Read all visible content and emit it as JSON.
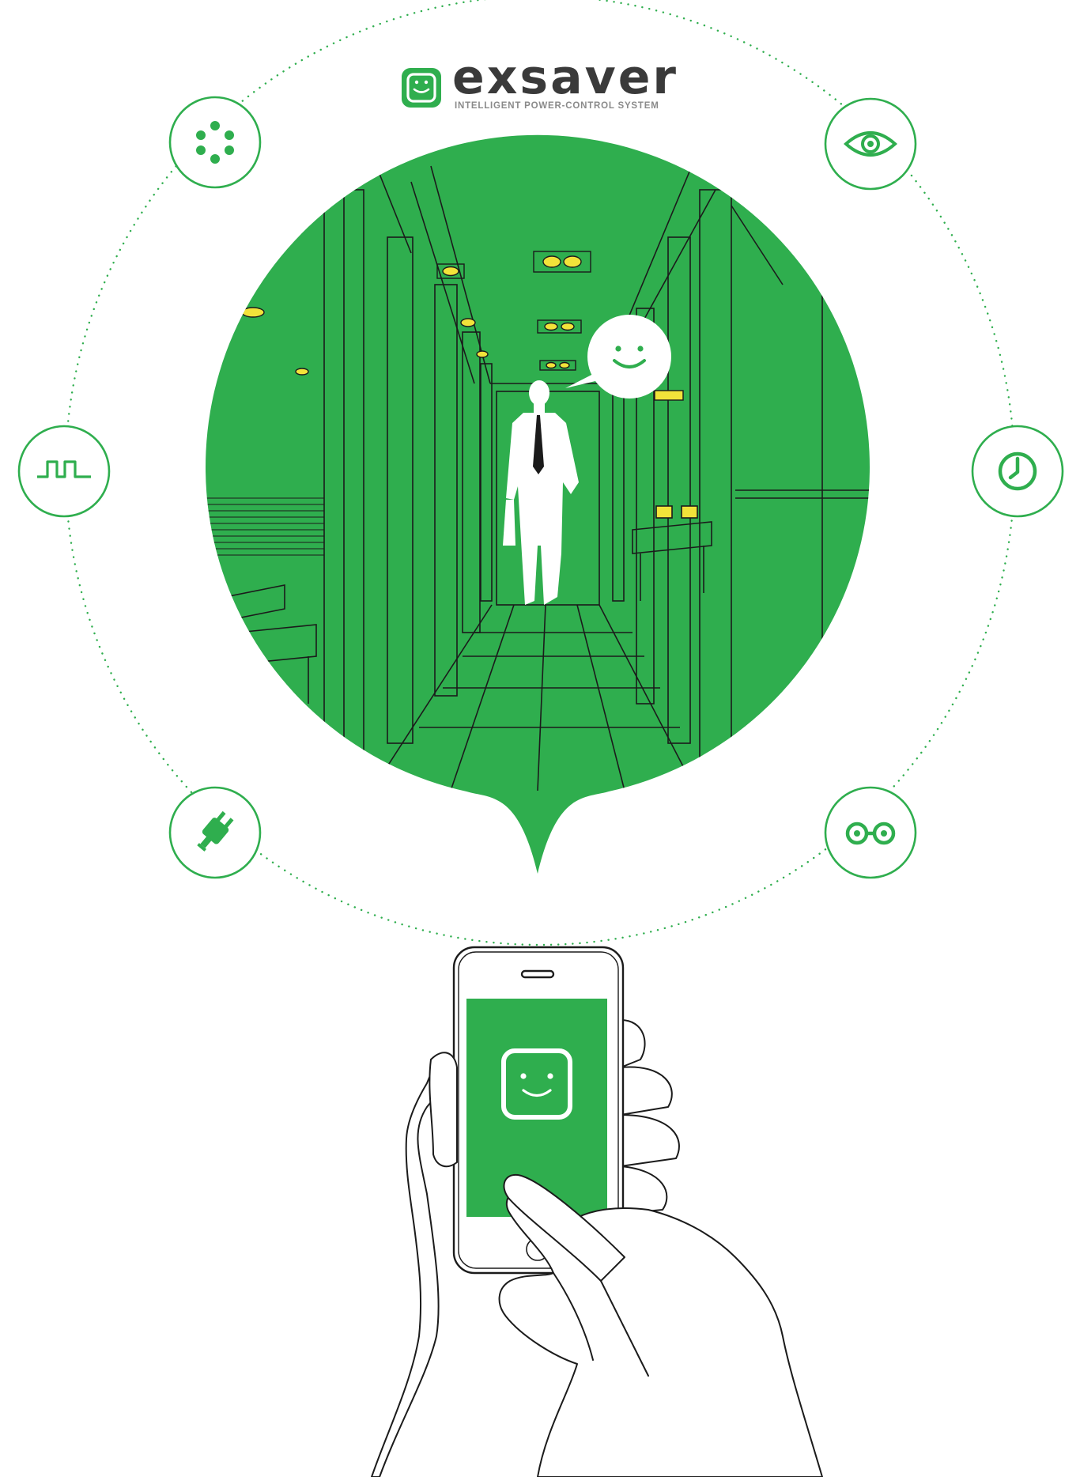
{
  "brand": {
    "name": "exsaver",
    "tagline": "INTELLIGENT POWER-CONTROL SYSTEM"
  },
  "colors": {
    "accent": "#2fae4e",
    "line": "#1b1b1b",
    "lamp": "#f2e33a",
    "text_dark": "#3a3a3a",
    "text_muted": "#8a8a8a"
  },
  "feature_icons": [
    {
      "name": "dots-cluster-icon"
    },
    {
      "name": "eye-icon"
    },
    {
      "name": "pulse-wave-icon"
    },
    {
      "name": "clock-icon"
    },
    {
      "name": "plug-icon"
    },
    {
      "name": "linked-circles-icon"
    }
  ],
  "scene": {
    "speech_bubble_icon": "smiley-face-icon",
    "phone_screen_icon": "smiley-face-icon"
  }
}
